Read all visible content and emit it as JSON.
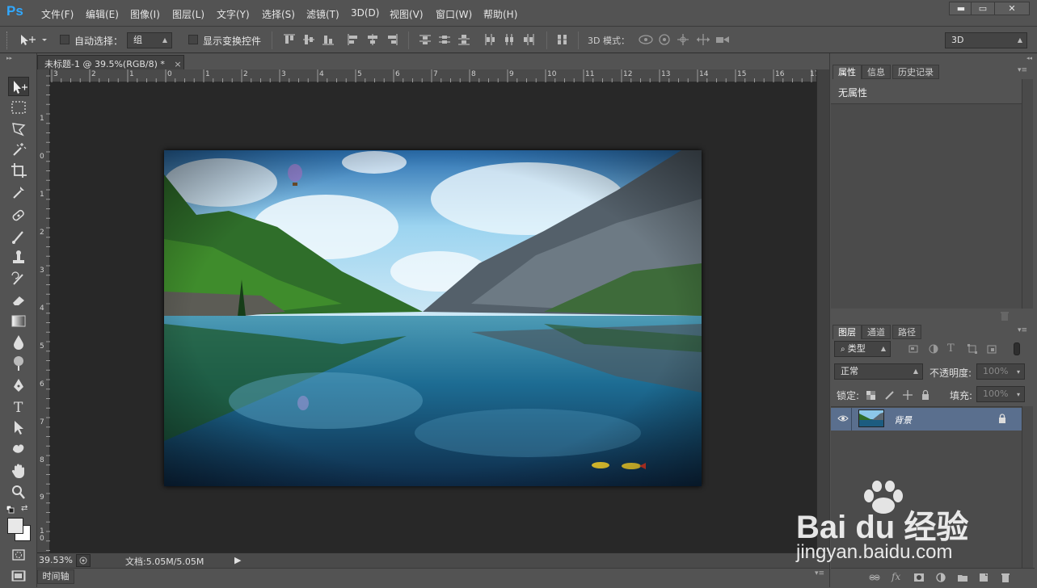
{
  "app": {
    "logo": "Ps"
  },
  "menu": [
    "文件(F)",
    "编辑(E)",
    "图像(I)",
    "图层(L)",
    "文字(Y)",
    "选择(S)",
    "滤镜(T)",
    "3D(D)",
    "视图(V)",
    "窗口(W)",
    "帮助(H)"
  ],
  "window_controls": {
    "minimize": "▬",
    "maximize": "▭",
    "close": "✕"
  },
  "options": {
    "auto_select_label": "自动选择：",
    "auto_select_value": "组",
    "show_transform_label": "显示变换控件",
    "mode_3d_label": "3D 模式：",
    "workspace_value": "3D"
  },
  "document": {
    "tab_title": "未标题-1 @ 39.5%(RGB/8) *",
    "tab_close": "×",
    "ruler_top": [
      "3",
      "2",
      "1",
      "0",
      "1",
      "2",
      "3",
      "4",
      "5",
      "6",
      "7",
      "8",
      "9",
      "10",
      "11",
      "12",
      "13",
      "14",
      "15",
      "16",
      "17"
    ],
    "ruler_left": [
      "1",
      "0",
      "1",
      "2",
      "3",
      "4",
      "5",
      "6",
      "7",
      "8",
      "9",
      "1\n0"
    ]
  },
  "status": {
    "zoom": "39.53%",
    "doc_info": "文档:5.05M/5.05M",
    "arrow": "▶"
  },
  "timeline": {
    "label": "时间轴"
  },
  "properties_panel": {
    "tabs": [
      "属性",
      "信息",
      "历史记录"
    ],
    "content": "无属性"
  },
  "layers_panel": {
    "tabs": [
      "图层",
      "通道",
      "路径"
    ],
    "filter_type": "类型",
    "blend_mode": "正常",
    "opacity_label": "不透明度:",
    "opacity_value": "100%",
    "lock_label": "锁定:",
    "fill_label": "填充:",
    "fill_value": "100%",
    "layers": [
      {
        "name": "背景",
        "visible": true,
        "locked": true
      }
    ]
  },
  "watermark": {
    "brand": "Bai du 经验",
    "url": "jingyan.baidu.com"
  },
  "colors": {
    "ui_bg": "#535353",
    "canvas_bg": "#282828",
    "selected_layer": "#5a6f8e",
    "ps_blue": "#31a8ff"
  }
}
